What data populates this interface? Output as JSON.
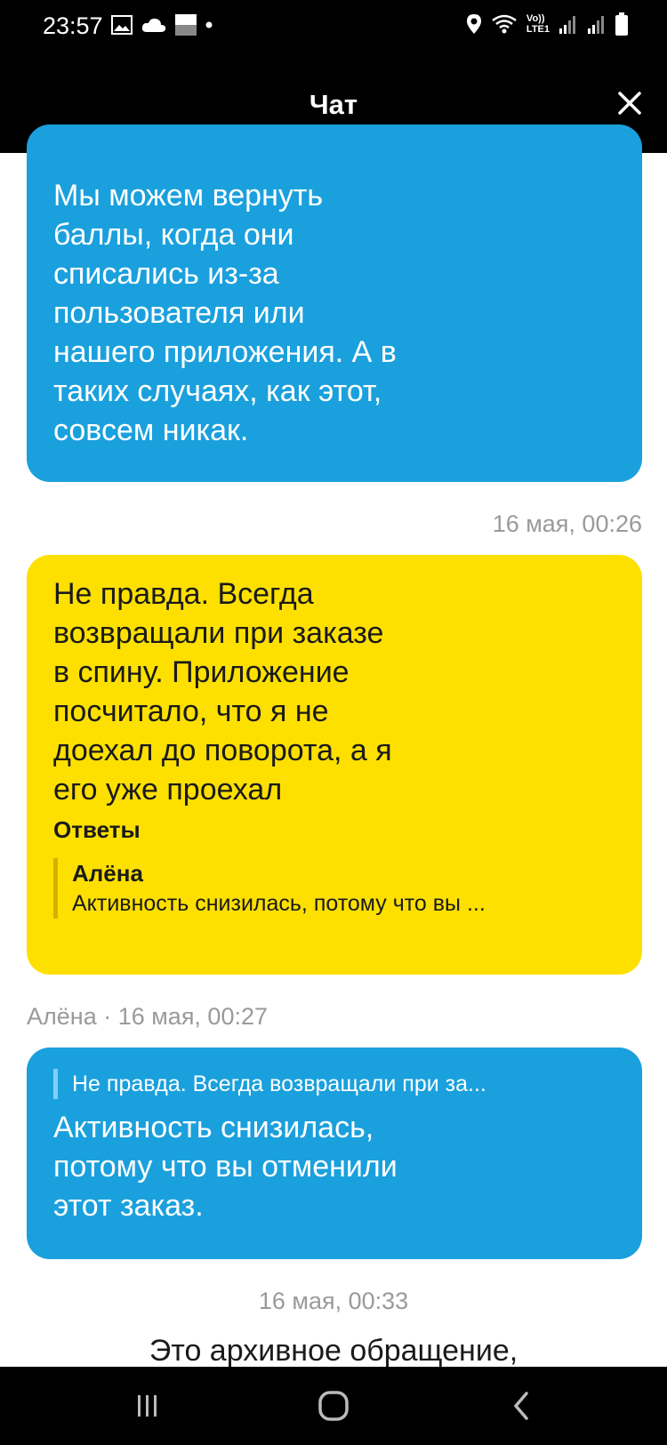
{
  "status_bar": {
    "time": "23:57",
    "left_icons": [
      "image-icon",
      "cloud-icon",
      "square-icon",
      "dot-icon"
    ],
    "right_icons": [
      "location-icon",
      "wifi-icon",
      "volte-icon",
      "signal-icon",
      "signal-icon",
      "battery-icon"
    ],
    "volte_label": "Vo))",
    "lte_label": "LTE1"
  },
  "header": {
    "title": "Чат",
    "close_icon": "close-icon"
  },
  "messages": [
    {
      "type": "incoming",
      "text": "Мы можем вернуть\nбаллы, когда они\nсписались из-за\nпользователя или\nнашего приложения. А в\nтаких случаях, как этот,\nсовсем никак."
    },
    {
      "type": "outgoing",
      "timestamp": "16 мая, 00:26",
      "text": "Не правда. Всегда\nвозвращали при заказе\nв спину. Приложение\nпосчитало, что я не\nдоехал до поворота, а я\nего уже проехал",
      "replies_label": "Ответы",
      "reply_name": "Алёна",
      "reply_text": "Активность снизилась, потому что вы ..."
    },
    {
      "type": "incoming",
      "author_meta": "Алёна · 16 мая, 00:27",
      "quote": "Не правда. Всегда возвращали при за...",
      "text": "Активность снизилась,\nпотому что вы отменили\nэтот заказ."
    }
  ],
  "last_timestamp": "16 мая, 00:33",
  "archive_notice": "Это архивное обращение,",
  "colors": {
    "incoming_bubble": "#1aa0dd",
    "outgoing_bubble": "#fde000",
    "header_bg": "#000000"
  },
  "nav_bar": {
    "buttons": [
      "recent-apps-icon",
      "home-icon",
      "back-icon"
    ]
  }
}
